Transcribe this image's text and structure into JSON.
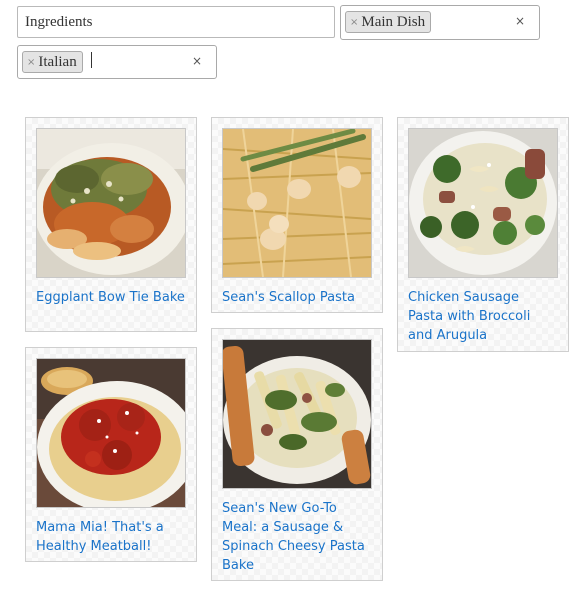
{
  "filters": {
    "ingredients_placeholder": "Ingredients",
    "course": {
      "selected": "Main Dish",
      "remove_glyph": "×",
      "clear_glyph": "×"
    },
    "cuisine": {
      "selected": "Italian",
      "remove_glyph": "×",
      "clear_glyph": "×"
    }
  },
  "recipes": [
    {
      "title": "Eggplant Bow Tie Bake",
      "photo_icon": "eggplant-bake-photo"
    },
    {
      "title": "Sean's Scallop Pasta",
      "photo_icon": "scallop-pasta-photo"
    },
    {
      "title": "Chicken Sausage Pasta with Broccoli and Arugula",
      "photo_icon": "sausage-broccoli-pasta-photo"
    },
    {
      "title": "Mama Mia! That's a Healthy Meatball!",
      "photo_icon": "meatball-spaghetti-photo"
    },
    {
      "title": "Sean's New Go-To Meal: a Sausage & Spinach Cheesy Pasta Bake",
      "photo_icon": "spinach-pasta-bake-photo"
    }
  ],
  "colors": {
    "link": "#1a73c9",
    "chip_bg": "#e4e4e4",
    "card_border": "#cfcfcf"
  }
}
